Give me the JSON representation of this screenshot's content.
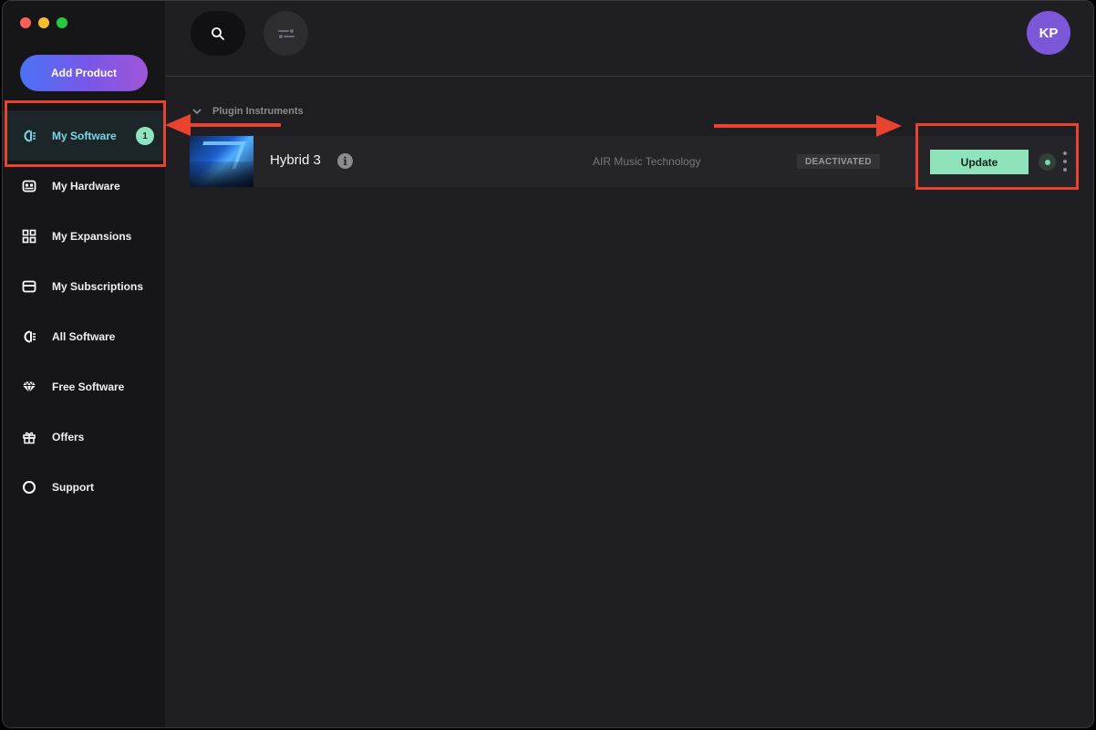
{
  "sidebar": {
    "add_product_label": "Add Product",
    "items": [
      {
        "label": "My Software",
        "icon": "software-icon",
        "badge": "1",
        "active": true
      },
      {
        "label": "My Hardware",
        "icon": "hardware-icon"
      },
      {
        "label": "My Expansions",
        "icon": "grid-icon"
      },
      {
        "label": "My Subscriptions",
        "icon": "card-icon"
      },
      {
        "label": "All Software",
        "icon": "software-icon"
      },
      {
        "label": "Free Software",
        "icon": "diamond-icon"
      },
      {
        "label": "Offers",
        "icon": "gift-icon"
      },
      {
        "label": "Support",
        "icon": "circle-icon"
      }
    ]
  },
  "topbar": {
    "avatar_initials": "KP"
  },
  "content": {
    "section_title": "Plugin Instruments",
    "product": {
      "name": "Hybrid 3",
      "vendor": "AIR Music Technology",
      "status": "DEACTIVATED",
      "action_label": "Update"
    }
  },
  "colors": {
    "accent_active": "#7bd7e6",
    "update_green": "#8fe3bb",
    "annotation_red": "#e8432e",
    "avatar_purple": "#7c58d9"
  }
}
